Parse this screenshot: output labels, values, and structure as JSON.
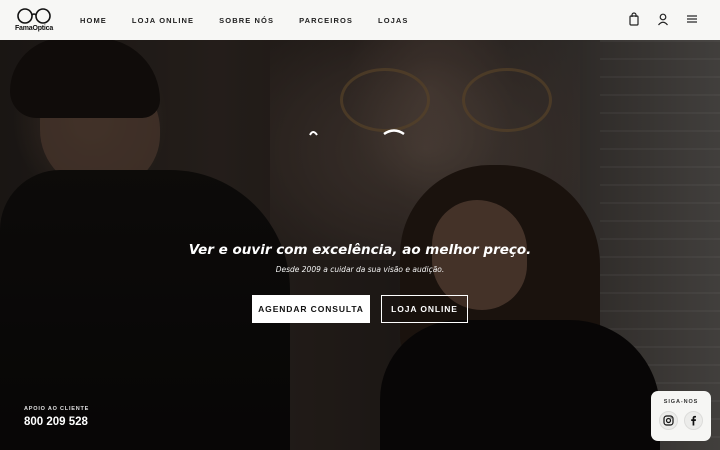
{
  "brand": {
    "name": "FamaOptica",
    "tagline_small": "desde 2009"
  },
  "nav": {
    "links": [
      "HOME",
      "LOJA ONLINE",
      "SOBRE NÓS",
      "PARCEIROS",
      "LOJAS"
    ],
    "icons": [
      "shopping-bag-icon",
      "user-icon",
      "menu-icon"
    ]
  },
  "hero": {
    "tagline": "Ver e ouvir com excelência, ao melhor preço.",
    "subtagline": "Desde 2009 a cuidar da sua visão e audição.",
    "primary_button": "AGENDAR CONSULTA",
    "secondary_button": "LOJA ONLINE"
  },
  "support": {
    "label": "APOIO AO CLIENTE",
    "phone": "800 209 528"
  },
  "social": {
    "title": "SIGA-NOS",
    "icons": [
      "instagram-icon",
      "facebook-icon"
    ]
  },
  "colors": {
    "navbar_bg": "#f7f7f5",
    "text_dark": "#111111",
    "text_light": "#ffffff"
  }
}
